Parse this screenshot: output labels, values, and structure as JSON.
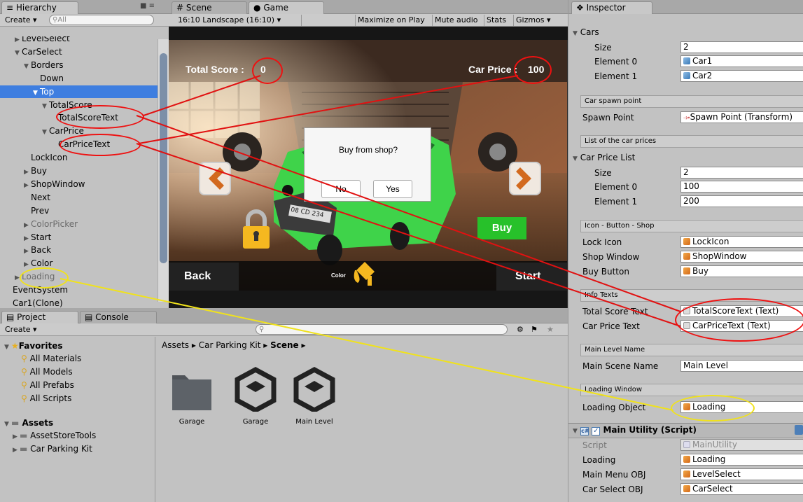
{
  "hierarchy": {
    "tab_label": "Hierarchy",
    "create_label": "Create",
    "search_placeholder": "All",
    "items": [
      {
        "label": "LevelSelect",
        "indent": 1,
        "arrow": "right"
      },
      {
        "label": "CarSelect",
        "indent": 1,
        "arrow": "down"
      },
      {
        "label": "Borders",
        "indent": 2,
        "arrow": "down"
      },
      {
        "label": "Down",
        "indent": 3,
        "arrow": ""
      },
      {
        "label": "Top",
        "indent": 3,
        "arrow": "down",
        "selected": true
      },
      {
        "label": "TotalScore",
        "indent": 4,
        "arrow": "down"
      },
      {
        "label": "TotalScoreText",
        "indent": 5,
        "arrow": ""
      },
      {
        "label": "CarPrice",
        "indent": 4,
        "arrow": "down"
      },
      {
        "label": "CarPriceText",
        "indent": 5,
        "arrow": ""
      },
      {
        "label": "LockIcon",
        "indent": 2,
        "arrow": ""
      },
      {
        "label": "Buy",
        "indent": 2,
        "arrow": "right"
      },
      {
        "label": "ShopWindow",
        "indent": 2,
        "arrow": "right"
      },
      {
        "label": "Next",
        "indent": 2,
        "arrow": ""
      },
      {
        "label": "Prev",
        "indent": 2,
        "arrow": ""
      },
      {
        "label": "ColorPicker",
        "indent": 2,
        "arrow": "right",
        "dim": true
      },
      {
        "label": "Start",
        "indent": 2,
        "arrow": "right"
      },
      {
        "label": "Back",
        "indent": 2,
        "arrow": "right"
      },
      {
        "label": "Color",
        "indent": 2,
        "arrow": "right"
      },
      {
        "label": "Loading",
        "indent": 1,
        "arrow": "right",
        "dim": true
      },
      {
        "label": "EventSystem",
        "indent": 0,
        "arrow": ""
      },
      {
        "label": "Car1(Clone)",
        "indent": 0,
        "arrow": ""
      }
    ]
  },
  "scene_tabs": {
    "scene": "Scene",
    "game": "Game"
  },
  "game_toolbar": {
    "aspect": "16:10 Landscape (16:10)",
    "maximize": "Maximize on Play",
    "mute": "Mute audio",
    "stats": "Stats",
    "gizmos": "Gizmos"
  },
  "game": {
    "total_score_label": "Total Score :",
    "total_score_value": "0",
    "car_price_label": "Car Price :",
    "car_price_value": "100",
    "dialog_question": "Buy from shop?",
    "dialog_no": "No",
    "dialog_yes": "Yes",
    "buy": "Buy",
    "back": "Back",
    "start": "Start",
    "color": "Color",
    "plate": "08 CD 234"
  },
  "project": {
    "tab_project": "Project",
    "tab_console": "Console",
    "create_label": "Create",
    "favorites_label": "Favorites",
    "favorites": [
      "All Materials",
      "All Models",
      "All Prefabs",
      "All Scripts"
    ],
    "assets_label": "Assets",
    "assets": [
      "AssetStoreTools",
      "Car Parking Kit"
    ],
    "breadcrumb": [
      "Assets",
      "Car Parking Kit",
      "Scene"
    ],
    "files": [
      "Garage",
      "Garage",
      "Main Level"
    ]
  },
  "inspector": {
    "tab_label": "Inspector",
    "cars_label": "Cars",
    "cars_size_label": "Size",
    "cars_size": "2",
    "element0_label": "Element 0",
    "element1_label": "Element 1",
    "cars": [
      "Car1",
      "Car2"
    ],
    "spawn_header": "Car spawn point",
    "spawn_label": "Spawn Point",
    "spawn_value": "Spawn Point (Transform)",
    "price_header": "List of the car prices",
    "price_list_label": "Car Price List",
    "price_size_label": "Size",
    "price_size": "2",
    "price_el0_label": "Element 0",
    "price_el1_label": "Element 1",
    "prices": [
      "100",
      "200"
    ],
    "ibs_header": "Icon - Button - Shop",
    "lock_icon_label": "Lock Icon",
    "lock_icon_value": "LockIcon",
    "shop_window_label": "Shop Window",
    "shop_window_value": "ShopWindow",
    "buy_button_label": "Buy Button",
    "buy_button_value": "Buy",
    "info_header": "Info Texts",
    "total_score_text_label": "Total Score Text",
    "total_score_text_value": "TotalScoreText (Text)",
    "car_price_text_label": "Car Price Text",
    "car_price_text_value": "CarPriceText (Text)",
    "main_level_header": "Main Level Name",
    "main_scene_label": "Main Scene Name",
    "main_scene_value": "Main Level",
    "loading_header": "Loading Window",
    "loading_object_label": "Loading Object",
    "loading_object_value": "Loading",
    "component_title": "Main Utility (Script)",
    "script_label": "Script",
    "script_value": "MainUtility",
    "loading_label": "Loading",
    "loading_value": "Loading",
    "main_menu_label": "Main Menu OBJ",
    "main_menu_value": "LevelSelect",
    "car_select_label": "Car Select OBJ",
    "car_select_value": "CarSelect"
  },
  "colors": {
    "selection": "#3e7ee0",
    "annotation_red": "#e11111",
    "annotation_yellow": "#f0e21c",
    "buy_green": "#27c12a"
  },
  "icons": [
    "lock-icon",
    "color-bucket-icon",
    "chevron-left-icon",
    "chevron-right-icon",
    "star-icon",
    "search-icon",
    "folder-icon",
    "unity-scene-icon"
  ]
}
